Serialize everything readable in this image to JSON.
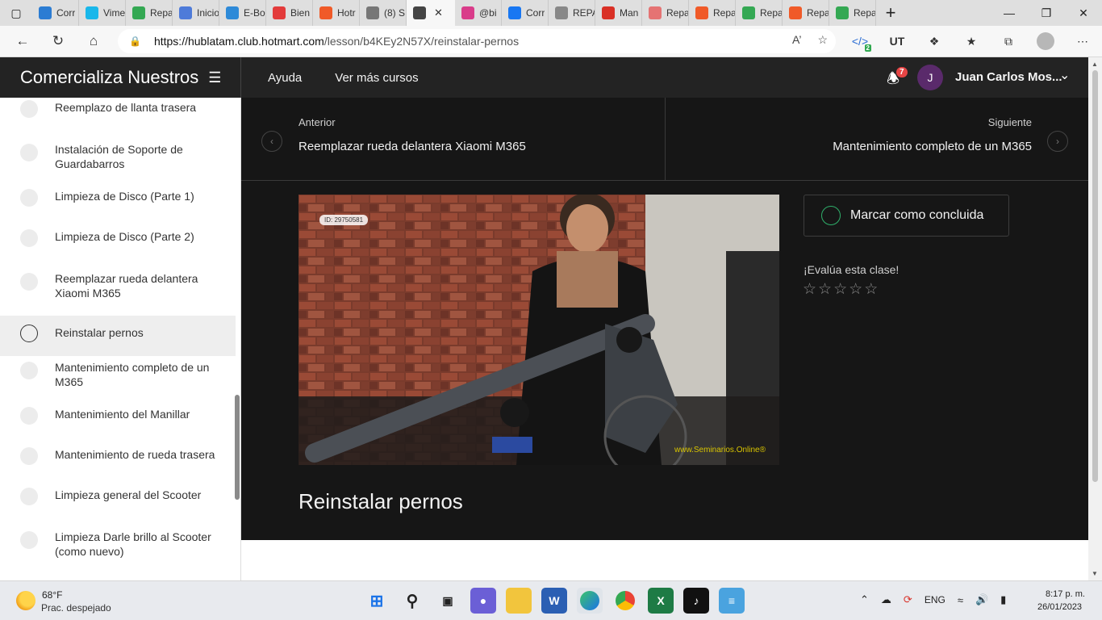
{
  "browser": {
    "tabs": [
      {
        "label": "Corr",
        "color": "#2b7cd3"
      },
      {
        "label": "Vime",
        "color": "#19b7ea"
      },
      {
        "label": "Repa",
        "color": "#34a853"
      },
      {
        "label": "Inicio",
        "color": "#4e7bd9"
      },
      {
        "label": "E-Bo",
        "color": "#2e8ad8"
      },
      {
        "label": "Bien",
        "color": "#e33b3b"
      },
      {
        "label": "Hotr",
        "color": "#f05a28"
      },
      {
        "label": "(8) S",
        "color": "#777777"
      },
      {
        "label": "",
        "color": "#444444",
        "active": true
      },
      {
        "label": "@bi",
        "color": "#d93c8a"
      },
      {
        "label": "Corr",
        "color": "#1877f2"
      },
      {
        "label": "REPA",
        "color": "#888888"
      },
      {
        "label": "Man",
        "color": "#d93025"
      },
      {
        "label": "Repa",
        "color": "#e57373"
      },
      {
        "label": "Repa",
        "color": "#f05a28"
      },
      {
        "label": "Repa",
        "color": "#34a853"
      },
      {
        "label": "Repa",
        "color": "#f05a28"
      },
      {
        "label": "Repa",
        "color": "#34a853"
      }
    ],
    "url_host": "https://hublatam.club.hotmart.com",
    "url_path": "/lesson/b4KEy2N57X/reinstalar-pernos",
    "ext_badge": "2"
  },
  "header": {
    "course_title": "Comercializa Nuestros",
    "nav_help": "Ayuda",
    "nav_more_courses": "Ver más cursos",
    "notification_count": "7",
    "avatar_initial": "J",
    "user_name": "Juan Carlos Mos..."
  },
  "sidebar": {
    "lessons": [
      {
        "label": "Reemplazo de llanta trasera"
      },
      {
        "label": "Instalación de Soporte de Guardabarros"
      },
      {
        "label": "Limpieza de Disco (Parte 1)"
      },
      {
        "label": "Limpieza de Disco (Parte 2)"
      },
      {
        "label": "Reemplazar rueda delantera Xiaomi M365"
      },
      {
        "label": "Reinstalar pernos",
        "current": true
      },
      {
        "label": "Mantenimiento completo de un M365"
      },
      {
        "label": "Mantenimiento del Manillar"
      },
      {
        "label": "Mantenimiento de rueda trasera"
      },
      {
        "label": "Limpieza general del Scooter"
      },
      {
        "label": "Limpieza Darle brillo al Scooter (como nuevo)"
      }
    ]
  },
  "lesson": {
    "prev_label": "Anterior",
    "prev_title": "Reemplazar rueda delantera Xiaomi M365",
    "next_label": "Siguiente",
    "next_title": "Mantenimiento completo de un M365",
    "video_id": "ID: 29750581",
    "video_watermark": "www.Seminarios.Online®",
    "mark_done": "Marcar como concluida",
    "rate_prompt": "¡Evalúa esta clase!",
    "rating": 0,
    "rating_max": 5,
    "title": "Reinstalar pernos"
  },
  "taskbar": {
    "weather_temp": "68°F",
    "weather_desc": "Prac. despejado",
    "language": "ENG",
    "time": "8:17 p. m.",
    "date": "26/01/2023"
  }
}
